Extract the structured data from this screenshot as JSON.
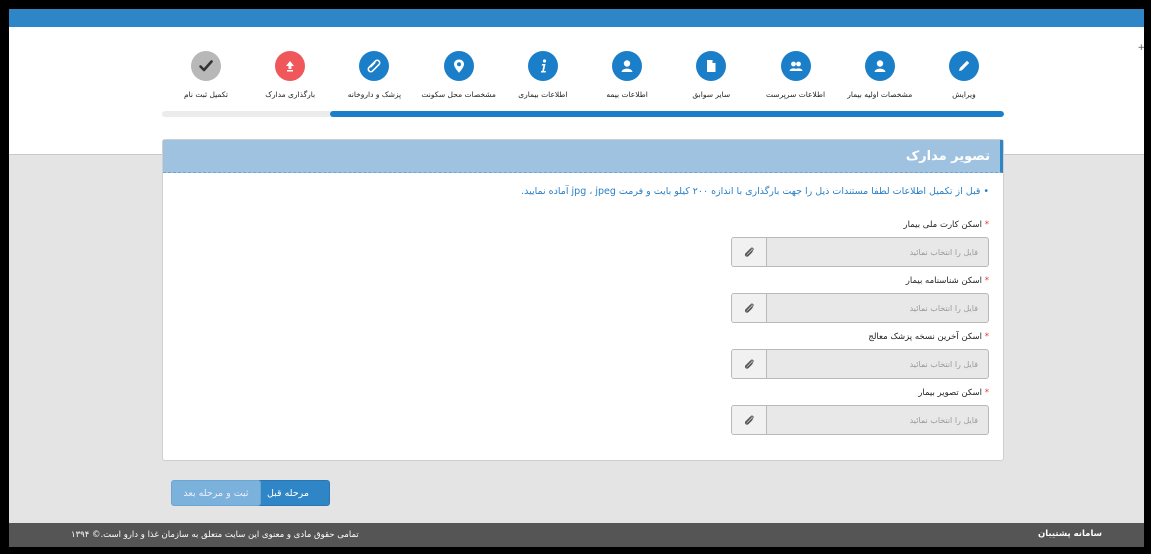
{
  "steps": [
    {
      "label": "ویرایش",
      "icon": "pencil-icon",
      "state": "future"
    },
    {
      "label": "مشخصات اولیه بیمار",
      "icon": "user-icon",
      "state": "future"
    },
    {
      "label": "اطلاعات سرپرست",
      "icon": "users-icon",
      "state": "future"
    },
    {
      "label": "سایر سوابق",
      "icon": "document-icon",
      "state": "future"
    },
    {
      "label": "اطلاعات بیمه",
      "icon": "user-icon",
      "state": "future"
    },
    {
      "label": "اطلاعات بیماری",
      "icon": "info-icon",
      "state": "future"
    },
    {
      "label": "مشخصات محل سکونت",
      "icon": "map-marker-icon",
      "state": "future"
    },
    {
      "label": "پزشک و داروخانه",
      "icon": "pill-icon",
      "state": "future"
    },
    {
      "label": "بارگذاری مدارک",
      "icon": "upload-icon",
      "state": "active"
    },
    {
      "label": "تکمیل ثبت نام",
      "icon": "check-icon",
      "state": "done"
    }
  ],
  "progress_fraction": 0.8,
  "panel": {
    "title": "تصویر مدارک",
    "note": "• قبل از تکمیل اطلاعات لطفا مستندات ذیل را جهت بارگذاری با اندازه ۲۰۰ کیلو بایت و فرمت jpg ، jpeg آماده نمایید."
  },
  "fields": [
    {
      "label": "اسکن کارت ملی بیمار",
      "placeholder": "فایل را انتخاب نمائید"
    },
    {
      "label": "اسکن شناسنامه بیمار",
      "placeholder": "فایل را انتخاب نمائید"
    },
    {
      "label": "اسکن آخرین نسخه پزشک معالج",
      "placeholder": "فایل را انتخاب نمائید"
    },
    {
      "label": "اسکن تصویر بیمار",
      "placeholder": "فایل را انتخاب نمائید"
    }
  ],
  "buttons": {
    "prev": "مرحله قبل",
    "next": "ثبت و مرحله بعد"
  },
  "footer": {
    "copyright": "تمامی حقوق مادی و معنوی این سایت متعلق به   سازمان غذا و دارو  است.© ۱۳۹۴",
    "brand": "سامانه پشتیبان"
  },
  "colors": {
    "accent": "#2f86c7",
    "active_step": "#f0575b",
    "done_step": "#b8b8b8"
  }
}
